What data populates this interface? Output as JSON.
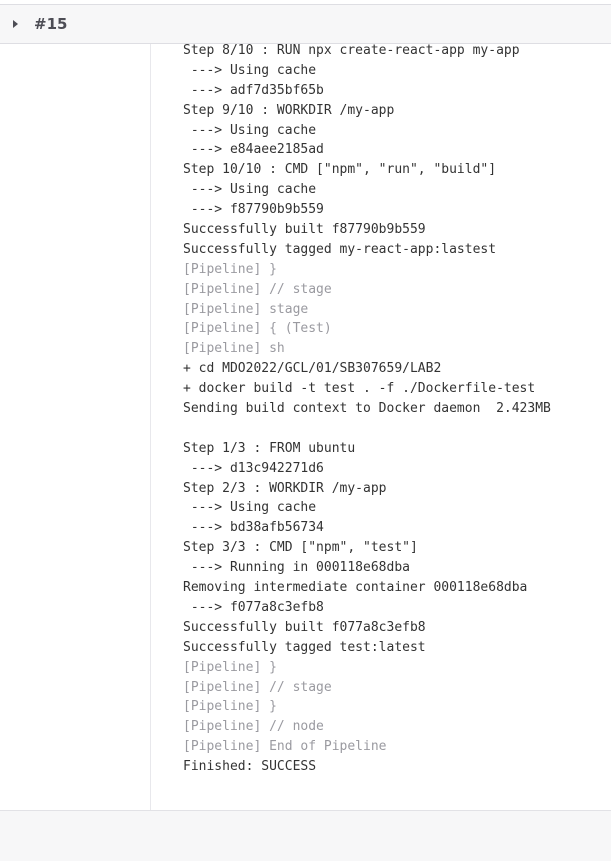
{
  "build": {
    "number": "#15"
  },
  "colors": {
    "text": "#333333",
    "pipeline_text": "#9a9aa0",
    "header_bg": "#f7f7f8"
  },
  "log_lines": [
    {
      "text": "Step 8/10 : RUN npx create-react-app my-app",
      "type": "output"
    },
    {
      "text": " ---> Using cache",
      "type": "output"
    },
    {
      "text": " ---> adf7d35bf65b",
      "type": "output"
    },
    {
      "text": "Step 9/10 : WORKDIR /my-app",
      "type": "output"
    },
    {
      "text": " ---> Using cache",
      "type": "output"
    },
    {
      "text": " ---> e84aee2185ad",
      "type": "output"
    },
    {
      "text": "Step 10/10 : CMD [\"npm\", \"run\", \"build\"]",
      "type": "output"
    },
    {
      "text": " ---> Using cache",
      "type": "output"
    },
    {
      "text": " ---> f87790b9b559",
      "type": "output"
    },
    {
      "text": "Successfully built f87790b9b559",
      "type": "output"
    },
    {
      "text": "Successfully tagged my-react-app:lastest",
      "type": "output"
    },
    {
      "text": "[Pipeline] }",
      "type": "pipeline"
    },
    {
      "text": "[Pipeline] // stage",
      "type": "pipeline"
    },
    {
      "text": "[Pipeline] stage",
      "type": "pipeline"
    },
    {
      "text": "[Pipeline] { (Test)",
      "type": "pipeline"
    },
    {
      "text": "[Pipeline] sh",
      "type": "pipeline"
    },
    {
      "text": "+ cd MDO2022/GCL/01/SB307659/LAB2",
      "type": "output"
    },
    {
      "text": "+ docker build -t test . -f ./Dockerfile-test",
      "type": "output"
    },
    {
      "text": "Sending build context to Docker daemon  2.423MB",
      "type": "output"
    },
    {
      "text": "",
      "type": "output"
    },
    {
      "text": "Step 1/3 : FROM ubuntu",
      "type": "output"
    },
    {
      "text": " ---> d13c942271d6",
      "type": "output"
    },
    {
      "text": "Step 2/3 : WORKDIR /my-app",
      "type": "output"
    },
    {
      "text": " ---> Using cache",
      "type": "output"
    },
    {
      "text": " ---> bd38afb56734",
      "type": "output"
    },
    {
      "text": "Step 3/3 : CMD [\"npm\", \"test\"]",
      "type": "output"
    },
    {
      "text": " ---> Running in 000118e68dba",
      "type": "output"
    },
    {
      "text": "Removing intermediate container 000118e68dba",
      "type": "output"
    },
    {
      "text": " ---> f077a8c3efb8",
      "type": "output"
    },
    {
      "text": "Successfully built f077a8c3efb8",
      "type": "output"
    },
    {
      "text": "Successfully tagged test:latest",
      "type": "output"
    },
    {
      "text": "[Pipeline] }",
      "type": "pipeline"
    },
    {
      "text": "[Pipeline] // stage",
      "type": "pipeline"
    },
    {
      "text": "[Pipeline] }",
      "type": "pipeline"
    },
    {
      "text": "[Pipeline] // node",
      "type": "pipeline"
    },
    {
      "text": "[Pipeline] End of Pipeline",
      "type": "pipeline"
    },
    {
      "text": "Finished: SUCCESS",
      "type": "output"
    }
  ]
}
